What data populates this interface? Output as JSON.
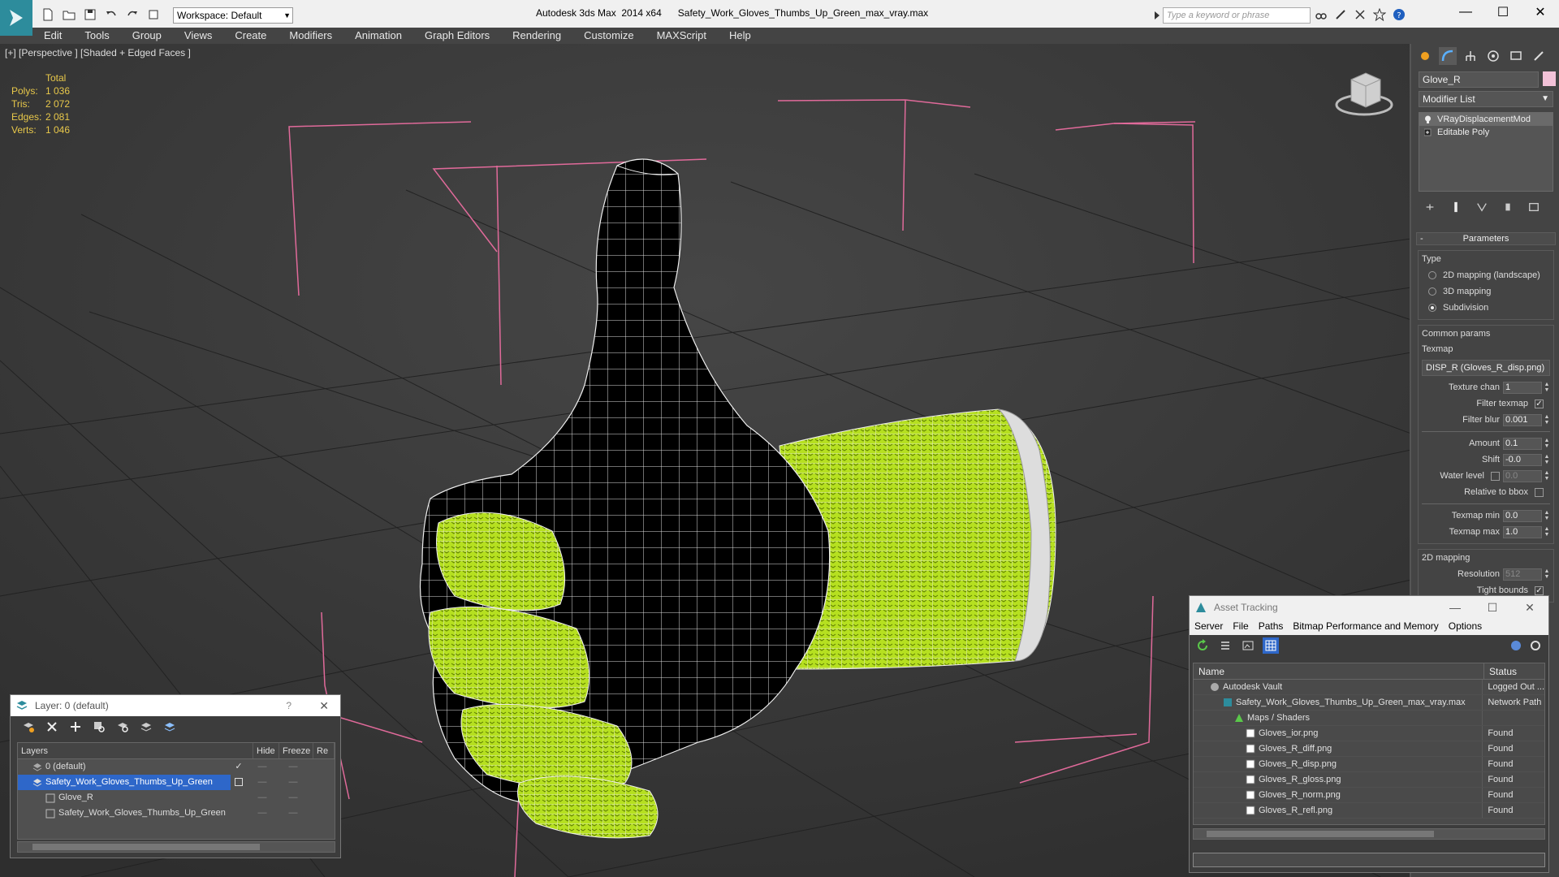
{
  "titlebar": {
    "workspace": "Workspace: Default",
    "app_title": "Autodesk 3ds Max  2014 x64      Safety_Work_Gloves_Thumbs_Up_Green_max_vray.max",
    "search_placeholder": "Type a keyword or phrase",
    "minimize": "—",
    "maximize": "☐",
    "close": "✕"
  },
  "menu": [
    "Edit",
    "Tools",
    "Group",
    "Views",
    "Create",
    "Modifiers",
    "Animation",
    "Graph Editors",
    "Rendering",
    "Customize",
    "MAXScript",
    "Help"
  ],
  "viewport": {
    "label": "[+] [Perspective ] [Shaded + Edged Faces ]",
    "stats": {
      "header": "Total",
      "rows": [
        {
          "k": "Polys:",
          "v": "1 036"
        },
        {
          "k": "Tris:",
          "v": "2 072"
        },
        {
          "k": "Edges:",
          "v": "2 081"
        },
        {
          "k": "Verts:",
          "v": "1 046"
        }
      ]
    }
  },
  "command_panel": {
    "object_name": "Glove_R",
    "object_color": "#f3c2d8",
    "modifier_list": "Modifier List",
    "stack": [
      {
        "label": "VRayDisplacementMod",
        "selected": true
      },
      {
        "label": "Editable Poly",
        "selected": false
      }
    ],
    "parameters": {
      "title": "Parameters",
      "type_label": "Type",
      "types": [
        {
          "label": "2D mapping (landscape)",
          "on": false
        },
        {
          "label": "3D mapping",
          "on": false
        },
        {
          "label": "Subdivision",
          "on": true
        }
      ],
      "common_params": "Common params",
      "texmap_label": "Texmap",
      "texmap_value": "DISP_R (Gloves_R_disp.png)",
      "texture_chan_label": "Texture chan",
      "texture_chan": "1",
      "filter_texmap_label": "Filter texmap",
      "filter_blur_label": "Filter blur",
      "filter_blur": "0.001",
      "amount_label": "Amount",
      "amount": "0.1",
      "shift_label": "Shift",
      "shift": "-0.0",
      "water_level_label": "Water level",
      "water_level": "0.0",
      "relative_bbox_label": "Relative to bbox",
      "texmap_min_label": "Texmap min",
      "texmap_min": "0.0",
      "texmap_max_label": "Texmap max",
      "texmap_max": "1.0",
      "mapping_2d": "2D mapping",
      "resolution_label": "Resolution",
      "resolution": "512",
      "tight_bounds_label": "Tight bounds"
    }
  },
  "layer_dialog": {
    "title": "Layer: 0 (default)",
    "help": "?",
    "close": "✕",
    "columns": [
      "Layers",
      "Hide",
      "Freeze",
      "Re"
    ],
    "rows": [
      {
        "name": "0 (default)",
        "indent": 1,
        "selected": false,
        "check": "✓"
      },
      {
        "name": "Safety_Work_Gloves_Thumbs_Up_Green",
        "indent": 1,
        "selected": true,
        "check": ""
      },
      {
        "name": "Glove_R",
        "indent": 2,
        "selected": false,
        "check": ""
      },
      {
        "name": "Safety_Work_Gloves_Thumbs_Up_Green",
        "indent": 2,
        "selected": false,
        "check": ""
      }
    ]
  },
  "asset_dialog": {
    "title": "Asset Tracking",
    "menu": [
      "Server",
      "File",
      "Paths",
      "Bitmap Performance and Memory",
      "Options"
    ],
    "columns": {
      "name": "Name",
      "status": "Status"
    },
    "rows": [
      {
        "name": "Autodesk Vault",
        "indent": 20,
        "status": "Logged Out ..."
      },
      {
        "name": "Safety_Work_Gloves_Thumbs_Up_Green_max_vray.max",
        "indent": 36,
        "status": "Network Path"
      },
      {
        "name": "Maps / Shaders",
        "indent": 50,
        "status": ""
      },
      {
        "name": "Gloves_ior.png",
        "indent": 64,
        "status": "Found"
      },
      {
        "name": "Gloves_R_diff.png",
        "indent": 64,
        "status": "Found"
      },
      {
        "name": "Gloves_R_disp.png",
        "indent": 64,
        "status": "Found"
      },
      {
        "name": "Gloves_R_gloss.png",
        "indent": 64,
        "status": "Found"
      },
      {
        "name": "Gloves_R_norm.png",
        "indent": 64,
        "status": "Found"
      },
      {
        "name": "Gloves_R_refl.png",
        "indent": 64,
        "status": "Found"
      }
    ]
  },
  "colors": {
    "glove_green": "#b6e020",
    "selection_blue": "#2e67c9",
    "bbox_pink": "#e06a9a",
    "stats_yellow": "#e8c84a"
  }
}
